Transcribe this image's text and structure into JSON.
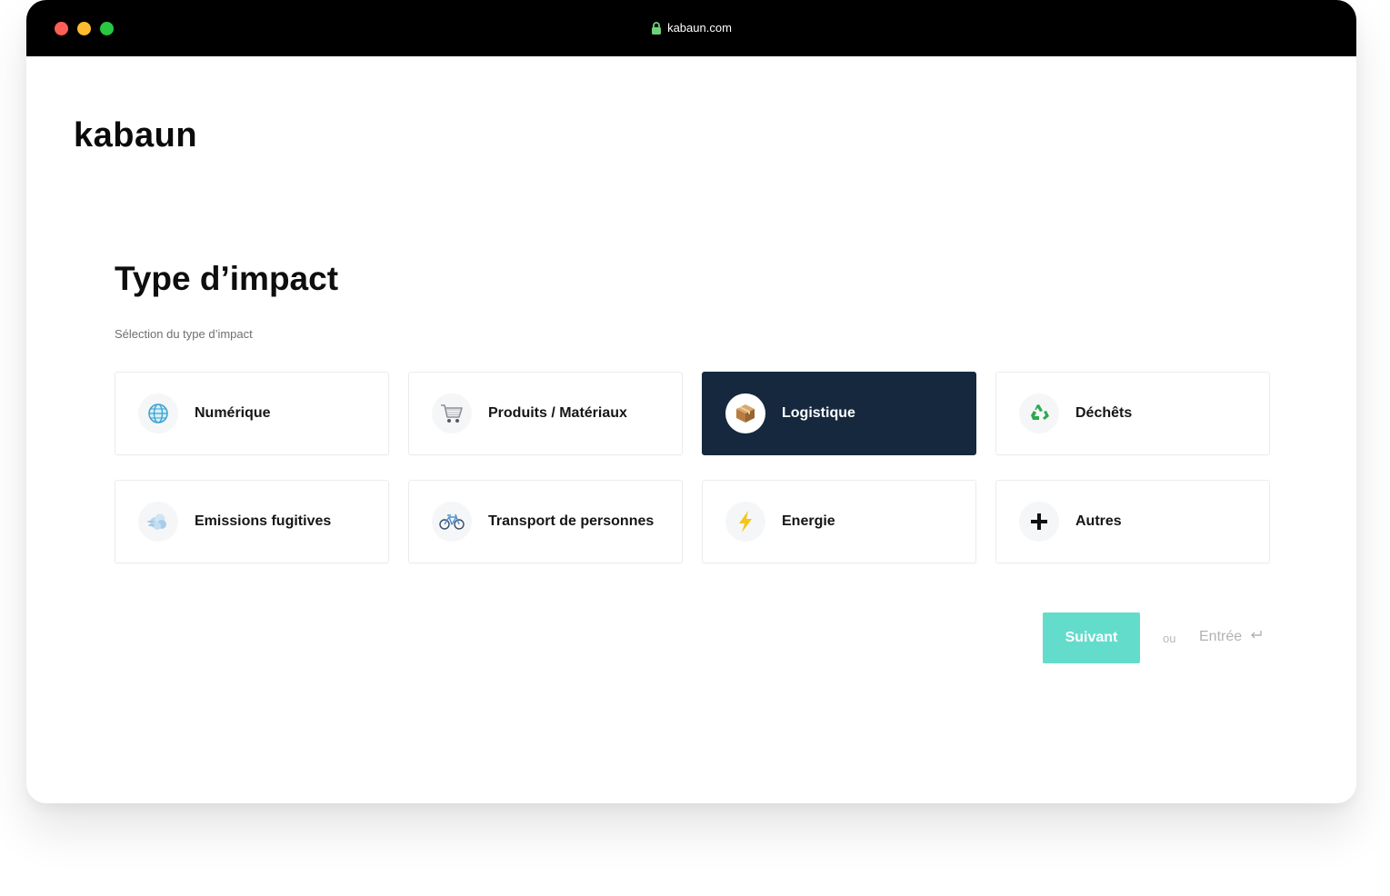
{
  "browser": {
    "url": "kabaun.com"
  },
  "brand": {
    "logo_text": "kabaun"
  },
  "page": {
    "title": "Type d’impact",
    "subtitle": "Sélection du type d’impact"
  },
  "options": [
    {
      "label": "Numérique",
      "icon": "globe-icon",
      "selected": false
    },
    {
      "label": "Produits / Matériaux",
      "icon": "shopping-cart-icon",
      "selected": false
    },
    {
      "label": "Logistique",
      "icon": "package-icon",
      "selected": true
    },
    {
      "label": "Déchêts",
      "icon": "recycle-icon",
      "selected": false
    },
    {
      "label": "Emissions fugitives",
      "icon": "cloud-icon",
      "selected": false
    },
    {
      "label": "Transport de personnes",
      "icon": "bicycle-icon",
      "selected": false
    },
    {
      "label": "Energie",
      "icon": "lightning-icon",
      "selected": false
    },
    {
      "label": "Autres",
      "icon": "plus-icon",
      "selected": false
    }
  ],
  "actions": {
    "next_label": "Suivant",
    "or_label": "ou",
    "enter_label": "Entrée"
  },
  "colors": {
    "selected_card": "#15283d",
    "next_button": "#64dccc",
    "titlebar": "#000000"
  }
}
